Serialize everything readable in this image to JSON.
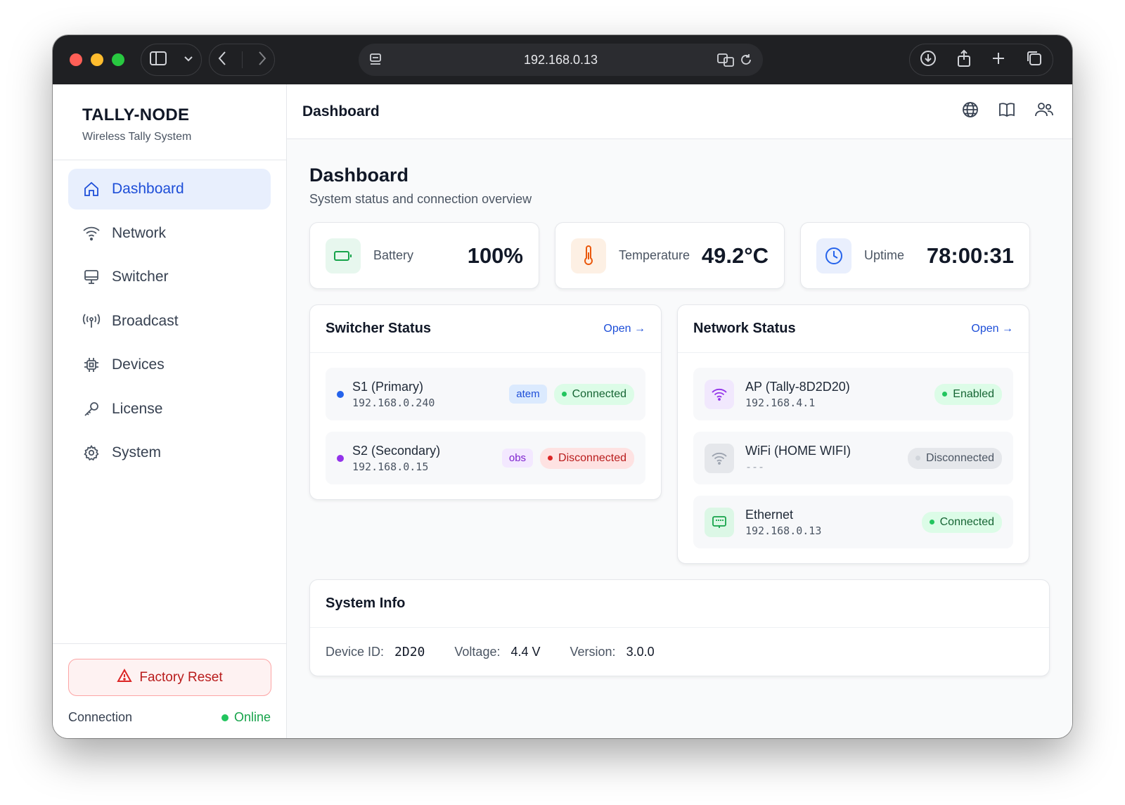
{
  "browser": {
    "url": "192.168.0.13"
  },
  "sidebar": {
    "brand_title": "TALLY-NODE",
    "brand_subtitle": "Wireless Tally System",
    "items": [
      {
        "label": "Dashboard",
        "icon": "home-icon",
        "active": true
      },
      {
        "label": "Network",
        "icon": "wifi-icon"
      },
      {
        "label": "Switcher",
        "icon": "monitor-icon"
      },
      {
        "label": "Broadcast",
        "icon": "broadcast-icon"
      },
      {
        "label": "Devices",
        "icon": "chip-icon"
      },
      {
        "label": "License",
        "icon": "key-icon"
      },
      {
        "label": "System",
        "icon": "gear-icon"
      }
    ],
    "factory_reset_label": "Factory Reset",
    "connection_label": "Connection",
    "connection_status": "Online"
  },
  "topbar": {
    "title": "Dashboard"
  },
  "page": {
    "title": "Dashboard",
    "subtitle": "System status and connection overview"
  },
  "stats": {
    "battery": {
      "label": "Battery",
      "value": "100%"
    },
    "temperature": {
      "label": "Temperature",
      "value": "49.2°C"
    },
    "uptime": {
      "label": "Uptime",
      "value": "78:00:31"
    }
  },
  "switcher_status": {
    "title": "Switcher Status",
    "open_label": "Open →",
    "rows": [
      {
        "name": "S1 (Primary)",
        "ip": "192.168.0.240",
        "tag": "atem",
        "status": "Connected"
      },
      {
        "name": "S2 (Secondary)",
        "ip": "192.168.0.15",
        "tag": "obs",
        "status": "Disconnected"
      }
    ]
  },
  "network_status": {
    "title": "Network Status",
    "open_label": "Open →",
    "rows": [
      {
        "name": "AP (Tally-8D2D20)",
        "ip": "192.168.4.1",
        "status": "Enabled"
      },
      {
        "name": "WiFi (HOME WIFI)",
        "ip": "---",
        "status": "Disconnected"
      },
      {
        "name": "Ethernet",
        "ip": "192.168.0.13",
        "status": "Connected"
      }
    ]
  },
  "system_info": {
    "title": "System Info",
    "device_id_label": "Device ID:",
    "device_id": "2D20",
    "voltage_label": "Voltage:",
    "voltage": "4.4 V",
    "version_label": "Version:",
    "version": "3.0.0"
  },
  "colors": {
    "accent": "#1d4ed8",
    "success": "#16a34a",
    "danger": "#dc2626",
    "warning": "#ea580c"
  }
}
